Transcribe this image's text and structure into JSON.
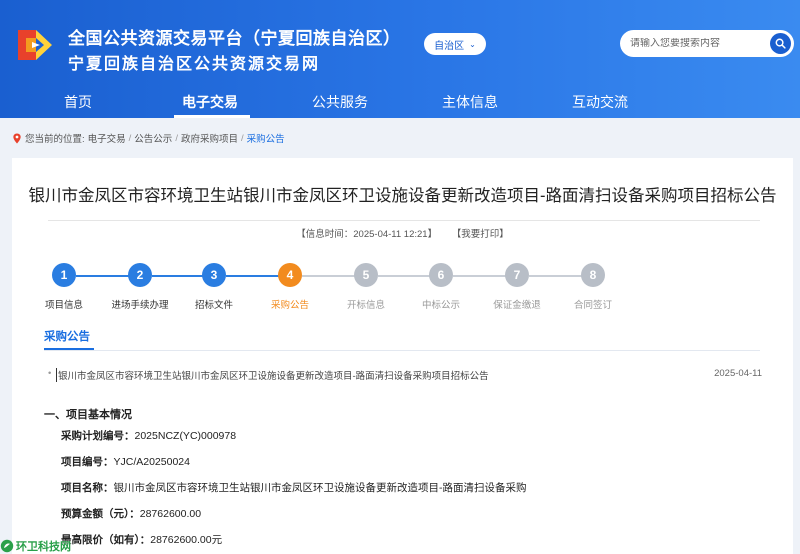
{
  "header": {
    "title": "全国公共资源交易平台（宁夏回族自治区）",
    "subtitle": "宁夏回族自治区公共资源交易网",
    "region_select": "自治区",
    "search_placeholder": "请输入您要搜索内容",
    "brand_color": "#2a76e6"
  },
  "nav": {
    "items": [
      "首页",
      "电子交易",
      "公共服务",
      "主体信息",
      "互动交流"
    ],
    "active": "电子交易"
  },
  "breadcrumb": {
    "prefix": "您当前的位置:",
    "items": [
      "电子交易",
      "公告公示",
      "政府采购项目",
      "采购公告"
    ],
    "separator": "/"
  },
  "notice": {
    "title": "银川市金凤区市容环境卫生站银川市金凤区环卫设施设备更新改造项目-路面清扫设备采购项目招标公告",
    "info_time": "【信息时间：2025-04-11 12:21】",
    "print_label": "【我要打印】"
  },
  "steps": [
    {
      "num": "1",
      "label": "项目信息",
      "state": "done"
    },
    {
      "num": "2",
      "label": "进场手续办理",
      "state": "done"
    },
    {
      "num": "3",
      "label": "招标文件",
      "state": "done"
    },
    {
      "num": "4",
      "label": "采购公告",
      "state": "current"
    },
    {
      "num": "5",
      "label": "开标信息",
      "state": "pending"
    },
    {
      "num": "6",
      "label": "中标公示",
      "state": "pending"
    },
    {
      "num": "7",
      "label": "保证金缴退",
      "state": "pending"
    },
    {
      "num": "8",
      "label": "合同签订",
      "state": "pending"
    }
  ],
  "step_colors": {
    "done": "#2a7de1",
    "current": "#f28b1e",
    "pending": "#b8bec7"
  },
  "section": {
    "tab": "采购公告",
    "item_text": "银川市金凤区市容环境卫生站银川市金凤区环卫设施设备更新改造项目-路面清扫设备采购项目招标公告",
    "item_date": "2025-04-11"
  },
  "body": {
    "heading": "一、项目基本情况",
    "fields": [
      {
        "k": "采购计划编号：",
        "v": "2025NCZ(YC)000978"
      },
      {
        "k": "项目编号：",
        "v": "YJC/A20250024"
      },
      {
        "k": "项目名称：",
        "v": "银川市金凤区市容环境卫生站银川市金凤区环卫设施设备更新改造项目-路面清扫设备采购"
      },
      {
        "k": "预算金额（元）：",
        "v": "28762600.00"
      },
      {
        "k": "最高限价（如有）：",
        "v": "28762600.00元"
      }
    ]
  },
  "watermark": {
    "text": "环卫科技网"
  }
}
